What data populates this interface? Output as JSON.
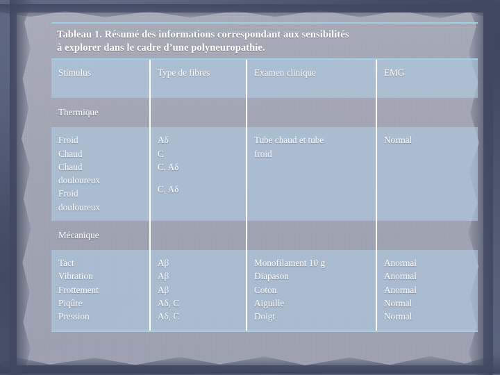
{
  "slide": {
    "accent_rule_color": "#9fd0e8",
    "cell_fill_color": "#b0cce2",
    "text_color": "#ffffff"
  },
  "caption": {
    "line1": "Tableau 1. Résumé des informations correspondant aux sensibilités",
    "line2": "à explorer  dans le cadre d’une polyneuropathie."
  },
  "table": {
    "columns": [
      "Stimulus",
      "Type de fibres",
      "Examen clinique",
      "EMG"
    ],
    "sections": [
      {
        "label": "Thermique",
        "rows": {
          "stimulus": "Froid\nChaud\nChaud\ndouloureux\nFroid\ndouloureux",
          "stimulus_lines": [
            "Froid",
            "Chaud",
            "Chaud",
            "douloureux",
            "Froid",
            "douloureux"
          ],
          "fibres_lines": [
            "Aδ",
            "C",
            "C, Aδ",
            "",
            "C, Aδ",
            ""
          ],
          "examen_lines": [
            "Tube chaud et tube",
            "froid"
          ],
          "emg_lines": [
            "Normal"
          ]
        }
      },
      {
        "label": "Mécanique",
        "rows": {
          "stimulus_lines": [
            "Tact",
            "Vibration",
            "Frottement",
            "Piqûre",
            "Pression"
          ],
          "fibres_lines": [
            "Aβ",
            "Aβ",
            "Aβ",
            "Aδ, C",
            "Aδ, C"
          ],
          "examen_lines": [
            "Monofilament 10 g",
            "Diapason",
            "Coton",
            "Aiguille",
            "Doigt"
          ],
          "emg_lines": [
            "Anormal",
            "Anormal",
            "Anormal",
            "Normal",
            "Normal"
          ]
        }
      }
    ]
  }
}
